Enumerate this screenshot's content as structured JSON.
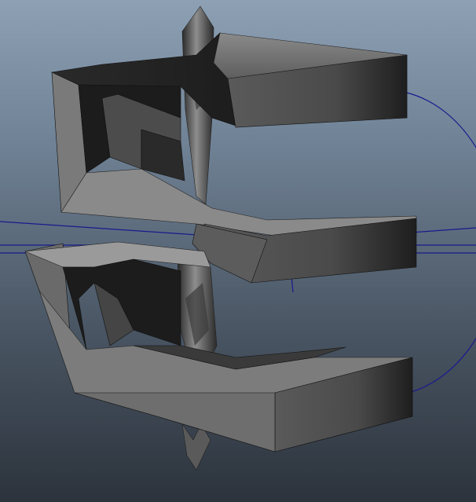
{
  "viewport": {
    "background_top": "#8da0b4",
    "background_bottom": "#2c333c",
    "object_color": "#6b6b6b",
    "manipulator_color": "#1a1a8c"
  },
  "scene": {
    "object": "twisted-spiral-mesh",
    "manipulator": "rotate-manipulator"
  }
}
